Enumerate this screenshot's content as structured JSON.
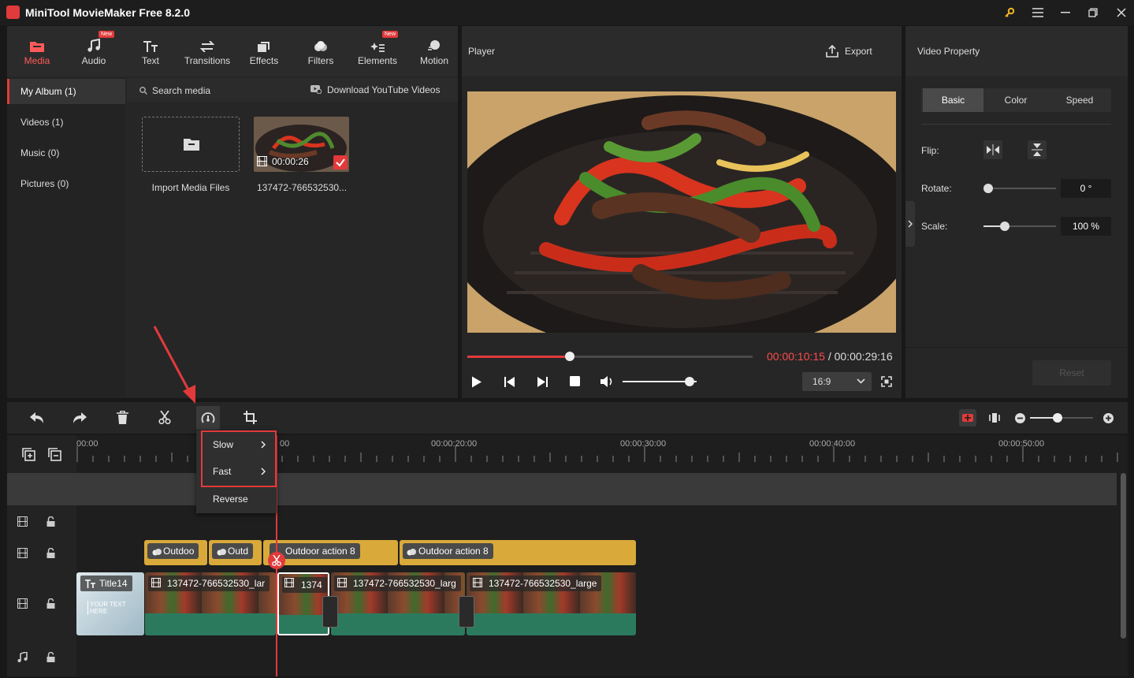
{
  "app": {
    "title": "MiniTool MovieMaker Free 8.2.0"
  },
  "tabs": [
    {
      "label": "Media",
      "icon": "media-folder-icon",
      "active": true,
      "badge": ""
    },
    {
      "label": "Audio",
      "icon": "music-note-icon",
      "badge": "New"
    },
    {
      "label": "Text",
      "icon": "text-icon",
      "badge": ""
    },
    {
      "label": "Transitions",
      "icon": "transitions-icon",
      "badge": ""
    },
    {
      "label": "Effects",
      "icon": "effects-icon",
      "badge": ""
    },
    {
      "label": "Filters",
      "icon": "filters-icon",
      "badge": ""
    },
    {
      "label": "Elements",
      "icon": "elements-icon",
      "badge": "New"
    },
    {
      "label": "Motion",
      "icon": "motion-icon",
      "badge": ""
    }
  ],
  "album": {
    "items": [
      "My Album (1)",
      "Videos (1)",
      "Music (0)",
      "Pictures (0)"
    ]
  },
  "media": {
    "search_placeholder": "Search media",
    "download_label": "Download YouTube Videos",
    "import_label": "Import Media Files",
    "clip_name": "137472-766532530...",
    "clip_duration": "00:00:26"
  },
  "player": {
    "title": "Player",
    "export_label": "Export",
    "current_time": "00:00:10:15",
    "separator": " / ",
    "total_time": "00:00:29:16",
    "progress": 0.36,
    "volume": 0.9,
    "aspect": "16:9"
  },
  "property": {
    "title": "Video Property",
    "tabs": [
      "Basic",
      "Color",
      "Speed"
    ],
    "flip_label": "Flip:",
    "rotate_label": "Rotate:",
    "rotate_value": "0 °",
    "scale_label": "Scale:",
    "scale_value": "100 %",
    "reset_label": "Reset"
  },
  "timeline": {
    "ticks": [
      "00:00",
      "00",
      "00:00:20:00",
      "00:00:30:00",
      "00:00:40:00",
      "00:00:50:00"
    ],
    "title_clip": "Title14",
    "title_overlay": "YOUR TEXT HERE",
    "effect_clips": [
      "Outdoo",
      "Outd",
      "Outdoor action 8",
      "Outdoor action 8"
    ],
    "video_clips": [
      "137472-766532530_lar",
      "1374",
      "137472-766532530_larg",
      "137472-766532530_large"
    ]
  },
  "speed_menu": {
    "items": [
      "Slow",
      "Fast",
      "Reverse"
    ]
  },
  "colors": {
    "accent": "#e23a3a",
    "track_yellow": "#d9a93a",
    "track_green": "#2c7a5e"
  }
}
